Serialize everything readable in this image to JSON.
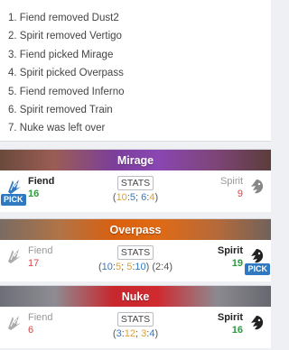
{
  "veto": [
    "1. Fiend removed Dust2",
    "2. Spirit removed Vertigo",
    "3. Fiend picked Mirage",
    "4. Spirit picked Overpass",
    "5. Fiend removed Inferno",
    "6. Spirit removed Train",
    "7. Nuke was left over"
  ],
  "maps": [
    {
      "name": "Mirage",
      "left": {
        "team": "Fiend",
        "score": "16"
      },
      "right": {
        "team": "Spirit",
        "score": "9"
      },
      "pick_label": "PICK",
      "stats_label": "STATS",
      "halves": {
        "open": "(",
        "h1a": "10",
        "sep1": ":",
        "h1b": "5",
        "mid": "; ",
        "h2a": "6",
        "sep2": ":",
        "h2b": "4",
        "close": ")"
      }
    },
    {
      "name": "Overpass",
      "left": {
        "team": "Fiend",
        "score": "17"
      },
      "right": {
        "team": "Spirit",
        "score": "19"
      },
      "pick_label": "PICK",
      "stats_label": "STATS",
      "halves": {
        "open": "(",
        "h1a": "10",
        "sep1": ":",
        "h1b": "5",
        "mid": "; ",
        "h2a": "5",
        "sep2": ":",
        "h2b": "10",
        "close": ")",
        "ot": " (2:4)"
      }
    },
    {
      "name": "Nuke",
      "left": {
        "team": "Fiend",
        "score": "6"
      },
      "right": {
        "team": "Spirit",
        "score": "16"
      },
      "stats_label": "STATS",
      "halves": {
        "open": "(",
        "h1a": "3",
        "sep1": ":",
        "h1b": "12",
        "mid": "; ",
        "h2a": "3",
        "sep2": ":",
        "h2b": "4",
        "close": ")"
      }
    }
  ],
  "colors": {
    "win": "#2e9b3f",
    "lose": "#d64545",
    "ct": "#2f78c2",
    "t": "#e2a02a",
    "pick": "#2f78c2"
  },
  "icons": {
    "fiend": "fiend-logo-icon",
    "spirit": "spirit-logo-icon"
  }
}
